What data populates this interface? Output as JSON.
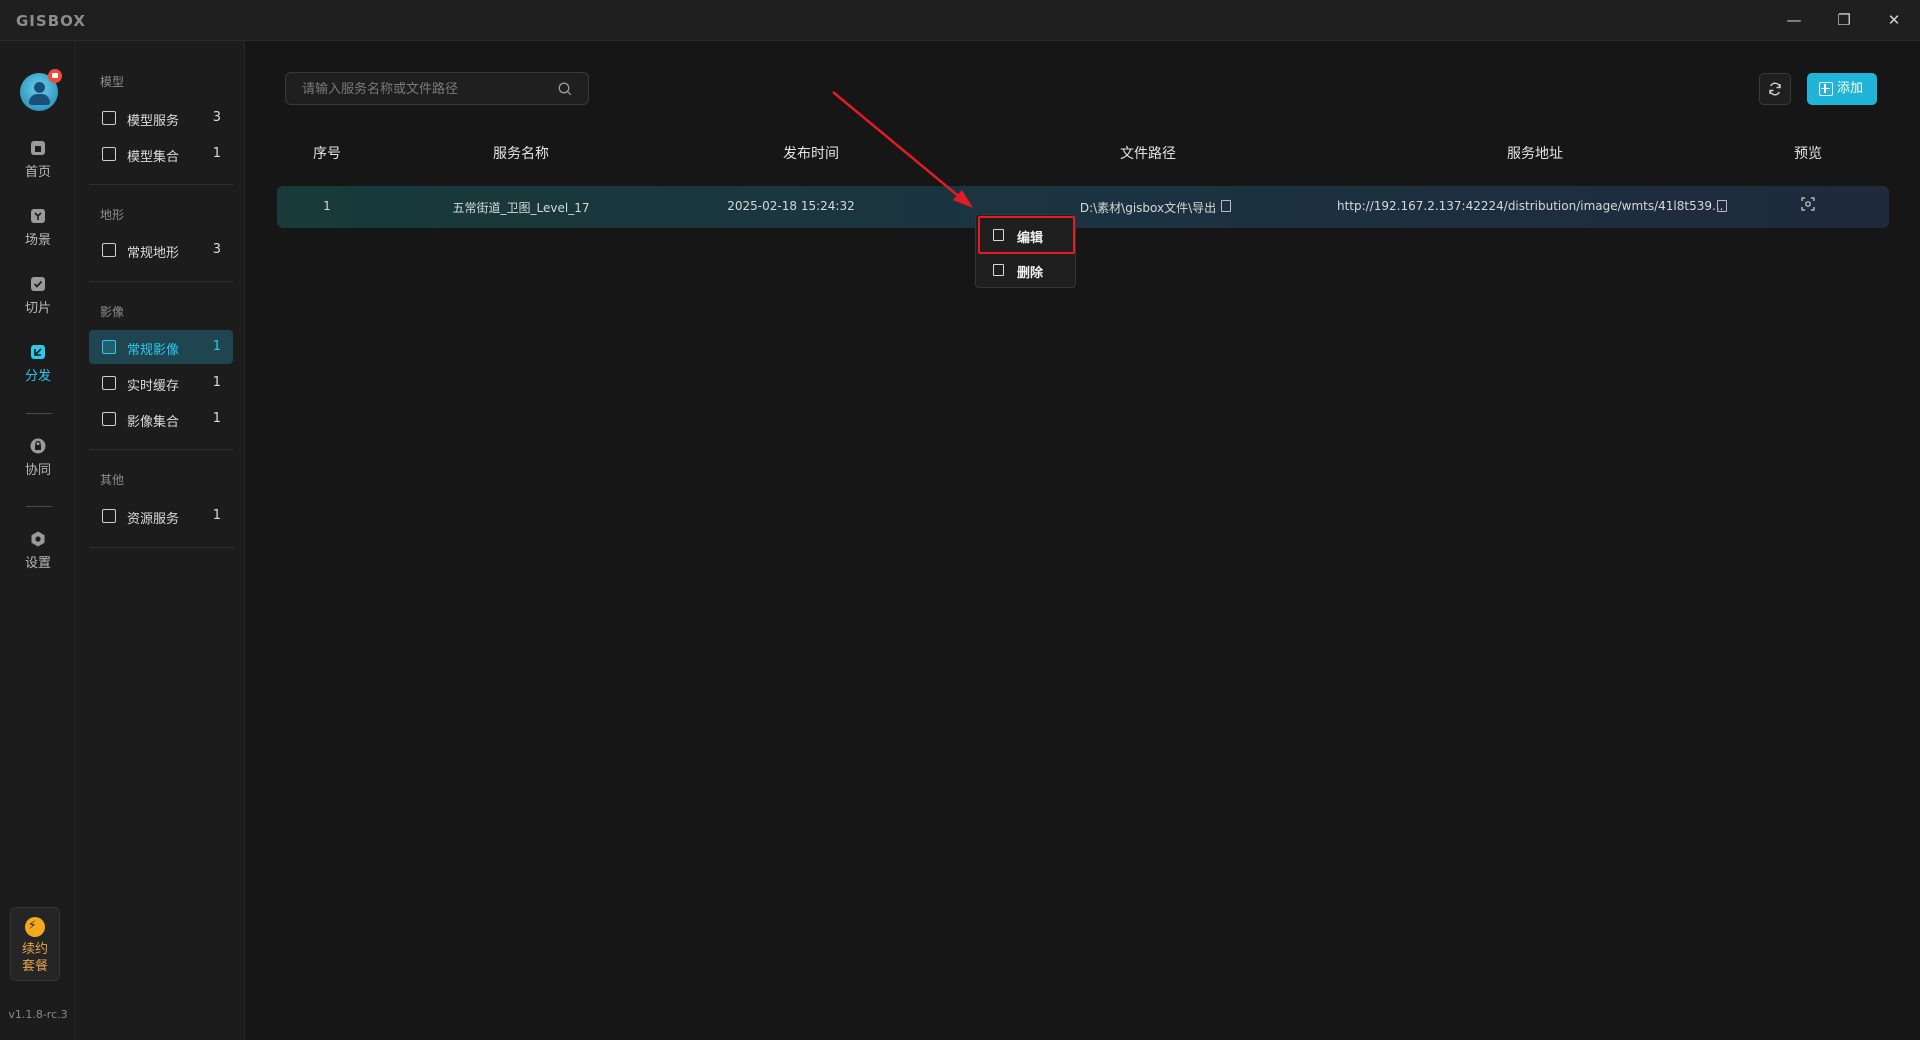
{
  "app": {
    "logo": "GISBOX"
  },
  "window": {
    "minimize": "—",
    "restore": "❐",
    "close": "✕"
  },
  "rail": {
    "items": [
      {
        "label": "首页",
        "icon": "home-icon"
      },
      {
        "label": "场景",
        "icon": "scene-icon"
      },
      {
        "label": "切片",
        "icon": "slice-icon"
      },
      {
        "label": "分发",
        "icon": "distribute-icon"
      },
      {
        "label": "协同",
        "icon": "collab-icon"
      },
      {
        "label": "设置",
        "icon": "settings-icon"
      }
    ],
    "renew_line1": "续约",
    "renew_line2": "套餐",
    "version": "v1.1.8-rc.3"
  },
  "sidebar": {
    "groups": [
      {
        "title": "模型",
        "items": [
          {
            "label": "模型服务",
            "count": "3"
          },
          {
            "label": "模型集合",
            "count": "1"
          }
        ]
      },
      {
        "title": "地形",
        "items": [
          {
            "label": "常规地形",
            "count": "3"
          }
        ]
      },
      {
        "title": "影像",
        "items": [
          {
            "label": "常规影像",
            "count": "1"
          },
          {
            "label": "实时缓存",
            "count": "1"
          },
          {
            "label": "影像集合",
            "count": "1"
          }
        ]
      },
      {
        "title": "其他",
        "items": [
          {
            "label": "资源服务",
            "count": "1"
          }
        ]
      }
    ]
  },
  "search": {
    "placeholder": "请输入服务名称或文件路径"
  },
  "toolbar": {
    "add_label": "添加"
  },
  "table": {
    "headers": [
      "序号",
      "服务名称",
      "发布时间",
      "文件路径",
      "服务地址",
      "预览"
    ],
    "rows": [
      {
        "index": "1",
        "name": "五常街道_卫图_Level_17",
        "time": "2025-02-18 15:24:32",
        "path": "D:\\素材\\gisbox文件\\导出",
        "url": "http://192.167.2.137:42224/distribution/image/wmts/41l8t539..."
      }
    ]
  },
  "context_menu": {
    "edit": "编辑",
    "delete": "删除"
  },
  "colors": {
    "accent": "#2ec8ea",
    "add_button": "#1fb4d8",
    "annotation": "#e51b23"
  }
}
